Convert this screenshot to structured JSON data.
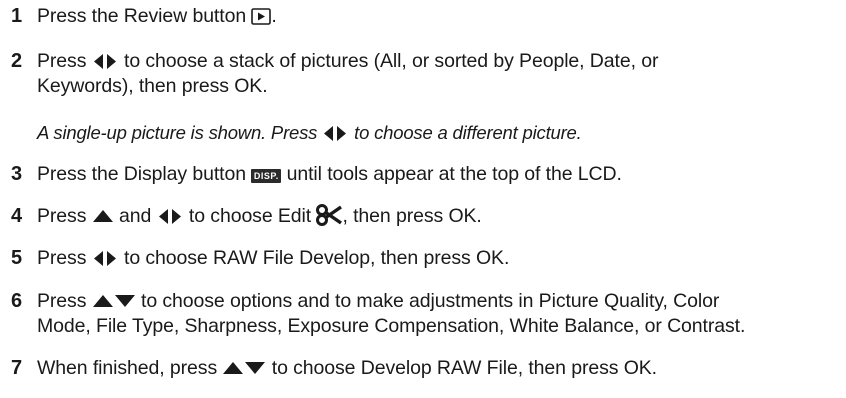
{
  "steps": [
    {
      "num": "1",
      "a": "Press the Review button",
      "b": "."
    },
    {
      "num": "2",
      "a": "Press",
      "b": "to choose a stack of pictures (All, or sorted by People, Date, or",
      "c": "Keywords), then press OK."
    },
    {
      "note": {
        "a": "A single-up picture is shown. Press",
        "b": "to choose a different picture."
      }
    },
    {
      "num": "3",
      "a": "Press the Display button",
      "disp": "DISP.",
      "b": "until tools appear at the top of the LCD."
    },
    {
      "num": "4",
      "a": "Press",
      "b": "and",
      "c": "to choose Edit",
      "d": ", then press OK."
    },
    {
      "num": "5",
      "a": "Press",
      "b": "to choose RAW File Develop, then press OK."
    },
    {
      "num": "6",
      "a": "Press",
      "b": "to choose options and to make adjustments in Picture Quality, Color",
      "c": "Mode, File Type, Sharpness, Exposure Compensation, White Balance, or Contrast."
    },
    {
      "num": "7",
      "a": "When finished, press",
      "b": "to choose Develop RAW File, then press OK."
    }
  ],
  "icons": {
    "review": "review-button-icon",
    "left_right": "left-right-arrows-icon",
    "up": "up-arrow-icon",
    "up_down": "up-down-arrows-icon",
    "edit": "scissors-edit-icon",
    "display": "display-button-icon"
  }
}
